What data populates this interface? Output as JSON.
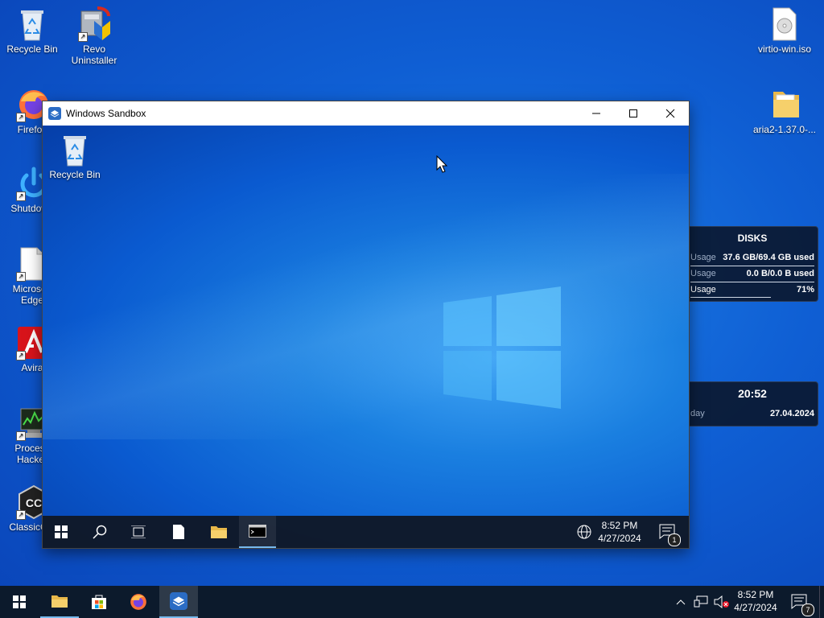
{
  "desktop": {
    "icons": [
      {
        "label": "Recycle Bin"
      },
      {
        "label": "Revo Uninstaller"
      },
      {
        "label": "Firefox"
      },
      {
        "label": "Shutdown"
      },
      {
        "label": "Microsoft Edge"
      },
      {
        "label": "Avira"
      },
      {
        "label": "Process Hacker"
      },
      {
        "label": "ClassicCut"
      },
      {
        "label": "virtio-win.iso"
      },
      {
        "label": "aria2-1.37.0-..."
      }
    ],
    "ring_label": "DISKS",
    "disk_widget": {
      "title": "DISKS",
      "rows": [
        {
          "label": "Usage",
          "value": "37.6 GB/69.4 GB used"
        },
        {
          "label": "Usage",
          "value": "0.0 B/0.0 B used"
        },
        {
          "label": "Usage",
          "value": "71%"
        }
      ]
    },
    "clock_widget": {
      "time": "20:52",
      "day_label": "day",
      "date": "27.04.2024"
    }
  },
  "sandbox": {
    "title": "Windows Sandbox",
    "desktop_icon_label": "Recycle Bin",
    "clock_time": "8:52 PM",
    "clock_date": "4/27/2024",
    "notification_count": "1"
  },
  "taskbar": {
    "clock_time": "8:52 PM",
    "clock_date": "4/27/2024",
    "notification_count": "7"
  }
}
